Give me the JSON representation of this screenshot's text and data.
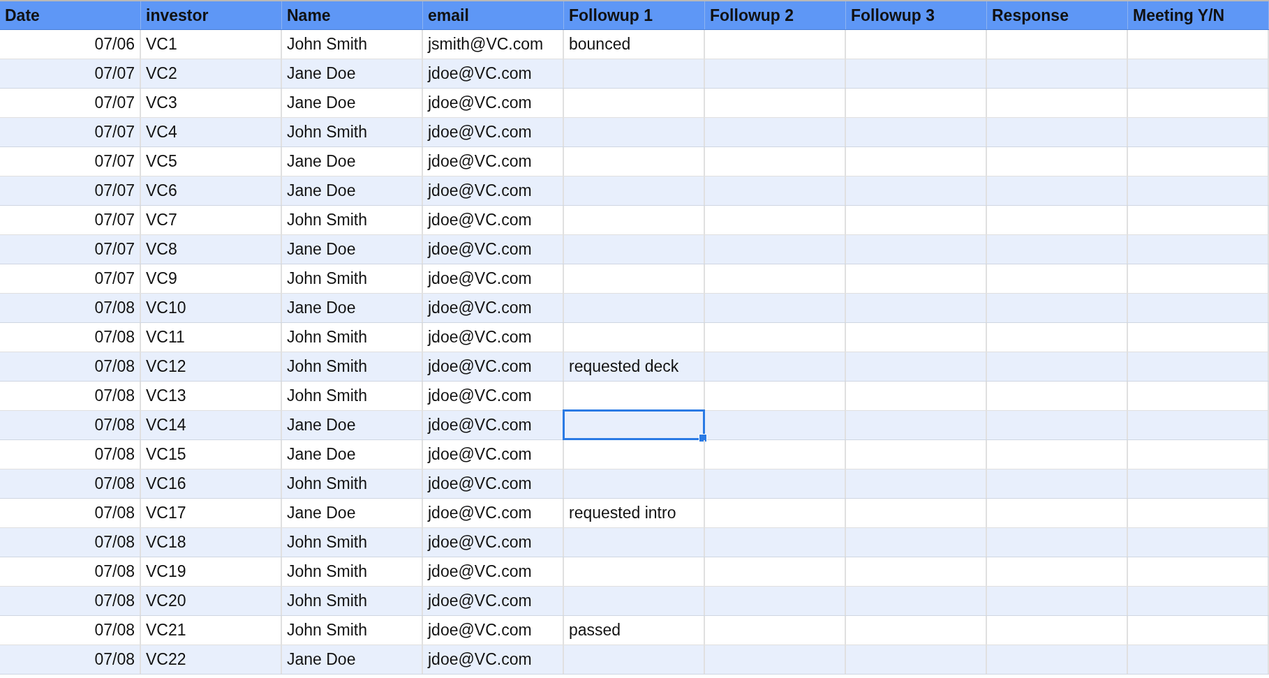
{
  "table": {
    "columns": [
      "Date",
      "investor",
      "Name",
      "email",
      "Followup 1",
      "Followup 2",
      "Followup 3",
      "Response",
      "Meeting Y/N"
    ],
    "rows": [
      {
        "date": "07/06",
        "investor": "VC1",
        "name": "John Smith",
        "email": "jsmith@VC.com",
        "followup_1": "bounced",
        "followup_1_selected": false
      },
      {
        "date": "07/07",
        "investor": "VC2",
        "name": "Jane Doe",
        "email": "jdoe@VC.com",
        "followup_1_selected": false
      },
      {
        "date": "07/07",
        "investor": "VC3",
        "name": "Jane Doe",
        "email": "jdoe@VC.com",
        "followup_1_selected": false
      },
      {
        "date": "07/07",
        "investor": "VC4",
        "name": "John Smith",
        "email": "jdoe@VC.com",
        "followup_1_selected": false
      },
      {
        "date": "07/07",
        "investor": "VC5",
        "name": "Jane Doe",
        "email": "jdoe@VC.com",
        "followup_1_selected": false
      },
      {
        "date": "07/07",
        "investor": "VC6",
        "name": "Jane Doe",
        "email": "jdoe@VC.com",
        "followup_1_selected": false
      },
      {
        "date": "07/07",
        "investor": "VC7",
        "name": "John Smith",
        "email": "jdoe@VC.com",
        "followup_1_selected": false
      },
      {
        "date": "07/07",
        "investor": "VC8",
        "name": "Jane Doe",
        "email": "jdoe@VC.com",
        "followup_1_selected": false
      },
      {
        "date": "07/07",
        "investor": "VC9",
        "name": "John Smith",
        "email": "jdoe@VC.com",
        "followup_1_selected": false
      },
      {
        "date": "07/08",
        "investor": "VC10",
        "name": "Jane Doe",
        "email": "jdoe@VC.com",
        "followup_1_selected": false
      },
      {
        "date": "07/08",
        "investor": "VC11",
        "name": "John Smith",
        "email": "jdoe@VC.com",
        "followup_1_selected": false
      },
      {
        "date": "07/08",
        "investor": "VC12",
        "name": "John Smith",
        "email": "jdoe@VC.com",
        "followup_1": "requested deck",
        "followup_1_selected": false
      },
      {
        "date": "07/08",
        "investor": "VC13",
        "name": "John Smith",
        "email": "jdoe@VC.com",
        "followup_1_selected": false
      },
      {
        "date": "07/08",
        "investor": "VC14",
        "name": "Jane Doe",
        "email": "jdoe@VC.com",
        "followup_1_selected": true
      },
      {
        "date": "07/08",
        "investor": "VC15",
        "name": "Jane Doe",
        "email": "jdoe@VC.com",
        "followup_1_selected": false
      },
      {
        "date": "07/08",
        "investor": "VC16",
        "name": "John Smith",
        "email": "jdoe@VC.com",
        "followup_1_selected": false
      },
      {
        "date": "07/08",
        "investor": "VC17",
        "name": "Jane Doe",
        "email": "jdoe@VC.com",
        "followup_1": "requested intro",
        "followup_1_selected": false
      },
      {
        "date": "07/08",
        "investor": "VC18",
        "name": "John Smith",
        "email": "jdoe@VC.com",
        "followup_1_selected": false
      },
      {
        "date": "07/08",
        "investor": "VC19",
        "name": "John Smith",
        "email": "jdoe@VC.com",
        "followup_1_selected": false
      },
      {
        "date": "07/08",
        "investor": "VC20",
        "name": "John Smith",
        "email": "jdoe@VC.com",
        "followup_1_selected": false
      },
      {
        "date": "07/08",
        "investor": "VC21",
        "name": "John Smith",
        "email": "jdoe@VC.com",
        "followup_1": "passed",
        "followup_1_selected": false
      },
      {
        "date": "07/08",
        "investor": "VC22",
        "name": "Jane Doe",
        "email": "jdoe@VC.com",
        "followup_1_selected": false
      }
    ]
  }
}
